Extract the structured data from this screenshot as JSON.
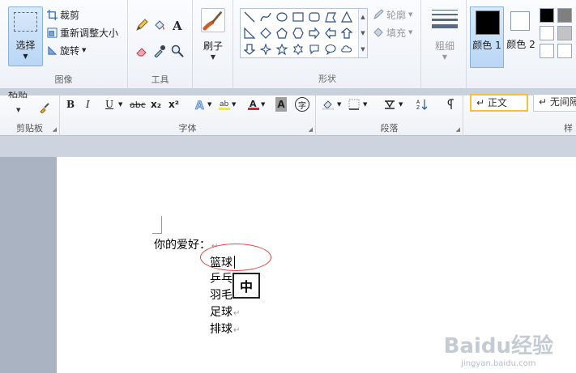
{
  "paint_ribbon": {
    "image": {
      "label": "图像",
      "select_label": "选择",
      "crop_label": "裁剪",
      "resize_label": "重新调整大小",
      "rotate_label": "旋转"
    },
    "tools": {
      "label": "工具"
    },
    "brush": {
      "label": "刷子"
    },
    "shapes": {
      "label": "形状",
      "outline_label": "轮廓",
      "fill_label": "填充"
    },
    "size": {
      "label": "粗细"
    },
    "colors": {
      "color1_label": "颜色 1",
      "color2_label": "颜色 2",
      "color1_value": "#000000",
      "color2_value": "#ffffff",
      "palette": [
        "#000000",
        "#7f7f7f",
        "#ffffff",
        "#c3c3c3",
        "#ffffff",
        "#ffffff"
      ]
    }
  },
  "word_ribbon": {
    "clipboard": {
      "label": "剪贴板",
      "paste_label": "粘贴"
    },
    "font": {
      "label": "字体",
      "bold": "B",
      "italic": "I",
      "underline": "U",
      "strike": "abc",
      "subscript": "x₂",
      "superscript": "x²",
      "char_shading": "A",
      "enclose_char": "字"
    },
    "paragraph": {
      "label": "段落"
    },
    "styles": {
      "label": "样",
      "style1": "↵ 正文",
      "style2": "↵ 无间隔"
    }
  },
  "document": {
    "question": "你的爱好：",
    "options": [
      "篮球",
      "乒乓",
      "羽毛",
      "足球",
      "排球"
    ],
    "pilcrow": "↵",
    "ime_mode": "中"
  },
  "watermark": {
    "brand": "Baidu经验",
    "url": "jingyan.baidu.com"
  }
}
